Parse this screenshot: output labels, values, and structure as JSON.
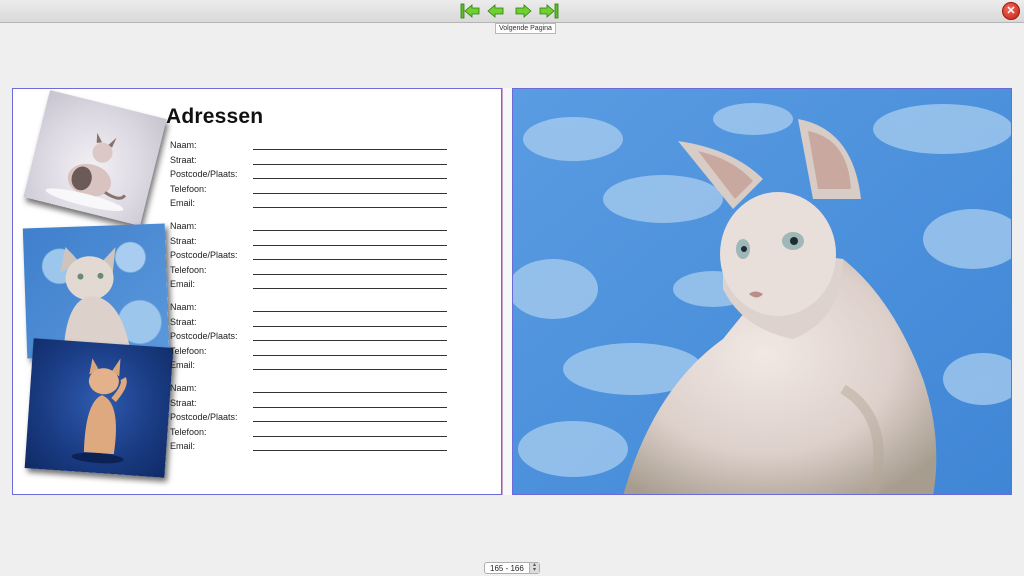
{
  "toolbar": {
    "buttons": [
      {
        "name": "first-page-button",
        "icon": "first-page-arrow-icon"
      },
      {
        "name": "previous-page-button",
        "icon": "left-arrow-icon"
      },
      {
        "name": "next-page-button",
        "icon": "right-arrow-icon"
      },
      {
        "name": "last-page-button",
        "icon": "last-page-arrow-icon"
      }
    ],
    "tooltip": "Volgende Pagina",
    "close_icon": "close-icon",
    "accent_color": "#5fbf2a"
  },
  "left_page": {
    "title": "Adressen",
    "forms": [
      {
        "fields": [
          "Naam:",
          "Straat:",
          "Postcode/Plaats:",
          "Telefoon:",
          "Email:"
        ]
      },
      {
        "fields": [
          "Naam:",
          "Straat:",
          "Postcode/Plaats:",
          "Telefoon:",
          "Email:"
        ]
      },
      {
        "fields": [
          "Naam:",
          "Straat:",
          "Postcode/Plaats:",
          "Telefoon:",
          "Email:"
        ]
      },
      {
        "fields": [
          "Naam:",
          "Straat:",
          "Postcode/Plaats:",
          "Telefoon:",
          "Email:"
        ]
      }
    ],
    "photos": [
      "sphynx-kitten-photo",
      "sphynx-cat-blue-sky-photo",
      "sphynx-cat-blue-backdrop-photo"
    ]
  },
  "right_page": {
    "photo": "sphynx-cat-portrait-photo"
  },
  "footer": {
    "page_range": "165 - 166"
  }
}
